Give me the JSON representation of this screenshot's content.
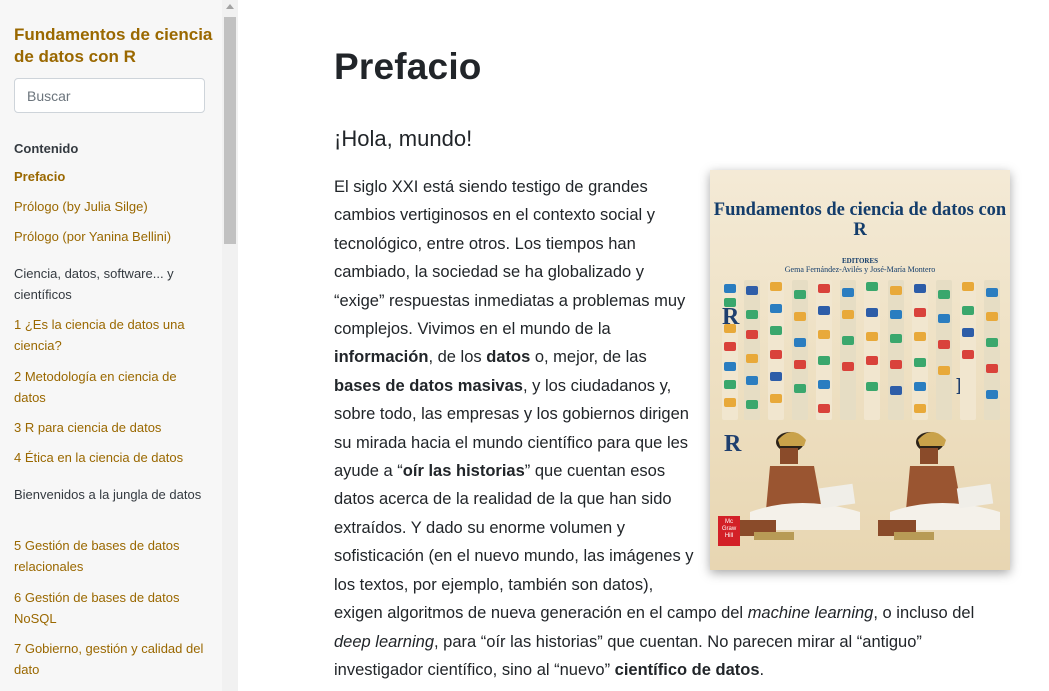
{
  "sidebar": {
    "book_title": "Fundamentos de ciencia de datos con R",
    "search_placeholder": "Buscar",
    "toc_heading": "Contenido",
    "items": [
      {
        "label": "Prefacio",
        "active": true
      },
      {
        "label": "Prólogo (by Julia Silge)"
      },
      {
        "label": "Prólogo (por Yanina Bellini)"
      },
      {
        "label": "Ciencia, datos, software... y científicos",
        "part": true
      },
      {
        "label": "1 ¿Es la ciencia de datos una ciencia?"
      },
      {
        "label": "2 Metodología en ciencia de datos"
      },
      {
        "label": "3 R para ciencia de datos"
      },
      {
        "label": "4 Ética en la ciencia de datos"
      },
      {
        "label": "Bienvenidos a la jungla de datos",
        "part": true
      },
      {
        "label": "5 Gestión de bases de datos relacionales"
      },
      {
        "label": "6 Gestión de bases de datos NoSQL"
      },
      {
        "label": "7 Gobierno, gestión y calidad del dato"
      }
    ]
  },
  "main": {
    "title": "Prefacio",
    "section_title": "¡Hola, mundo!",
    "paragraph": {
      "t1": "El siglo XXI está siendo testigo de grandes cambios vertiginosos en el contexto social y tecnológico, entre otros. Los tiempos han cambiado, la sociedad se ha globalizado y “exige” respuestas inmediatas a problemas muy complejos. Vivimos en el mundo de la ",
      "b1": "información",
      "t2": ", de los ",
      "b2": "datos",
      "t3": " o, mejor, de las ",
      "b3": "bases de datos masivas",
      "t4": ", y los ciudadanos y, sobre todo, las empresas y los gobiernos dirigen su mirada hacia el mundo científico para que les ayude a “",
      "b4": "oír las historias",
      "t5": "” que cuentan esos datos acerca de la realidad de la que han sido extraídos. Y dado su enorme volumen y sofisticación (en el nuevo mundo, las imágenes y los textos, por ejemplo, también son datos), exigen algoritmos de nueva generación en el campo del ",
      "i1": "machine learning",
      "t6": ", o incluso del ",
      "i2": "deep learning",
      "t7": ", para “oír las historias” que cuentan. No parecen mirar al “antiguo” investigador científico, sino al “nuevo” ",
      "b5": "científico de datos",
      "t8": "."
    },
    "cover": {
      "title": "Fundamentos de ciencia de datos con R",
      "editors_label": "EDITORES",
      "authors": "Gema Fernández-Avilés y José-María Montero",
      "publisher": "Mc Graw Hill"
    }
  },
  "colors": {
    "accent": "#9a6800",
    "text": "#212529",
    "sidebar_bg": "#f7f7f7"
  }
}
